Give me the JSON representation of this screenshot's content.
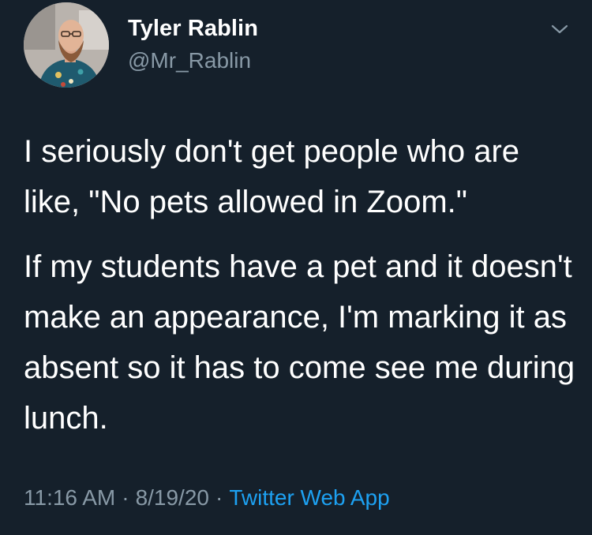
{
  "tweet": {
    "author": {
      "display_name": "Tyler Rablin",
      "handle": "@Mr_Rablin",
      "avatar_icon": "profile-photo"
    },
    "menu_icon": "chevron-down-icon",
    "paragraphs": [
      "I seriously don't get people who are like, \"No pets allowed in Zoom.\"",
      "If my students have a pet and it doesn't make an appearance, I'm marking it as absent so it has to come see me during lunch."
    ],
    "time": "11:16 AM",
    "date": "8/19/20",
    "separator": "·",
    "source": "Twitter Web App"
  },
  "colors": {
    "background": "#15202b",
    "text_primary": "#ffffff",
    "text_secondary": "#8899a6",
    "link": "#1da1f2"
  }
}
